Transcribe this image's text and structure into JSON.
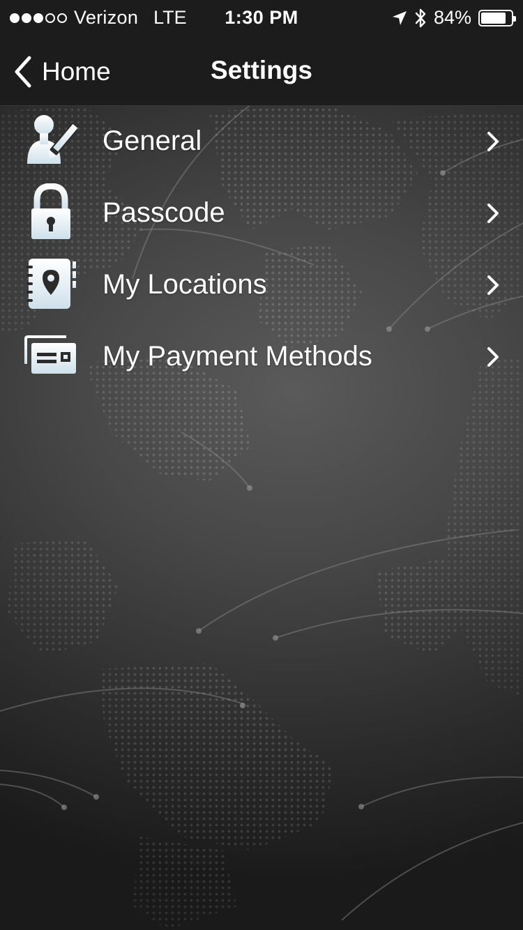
{
  "status_bar": {
    "signal_dots_filled": 3,
    "signal_dots_total": 5,
    "carrier": "Verizon",
    "network": "LTE",
    "time": "1:30 PM",
    "battery_percent": "84%",
    "battery_level": 0.84,
    "icons": [
      "location-arrow-icon",
      "bluetooth-icon",
      "battery-icon"
    ]
  },
  "nav": {
    "back_label": "Home",
    "title": "Settings"
  },
  "menu": {
    "items": [
      {
        "label": "General",
        "icon": "user-edit-icon"
      },
      {
        "label": "Passcode",
        "icon": "lock-icon"
      },
      {
        "label": "My Locations",
        "icon": "location-book-icon"
      },
      {
        "label": "My Payment Methods",
        "icon": "payment-cards-icon"
      }
    ]
  },
  "colors": {
    "bar_background": "#1c1c1c",
    "text": "#ffffff",
    "icon_light": "#e8f1f5"
  }
}
